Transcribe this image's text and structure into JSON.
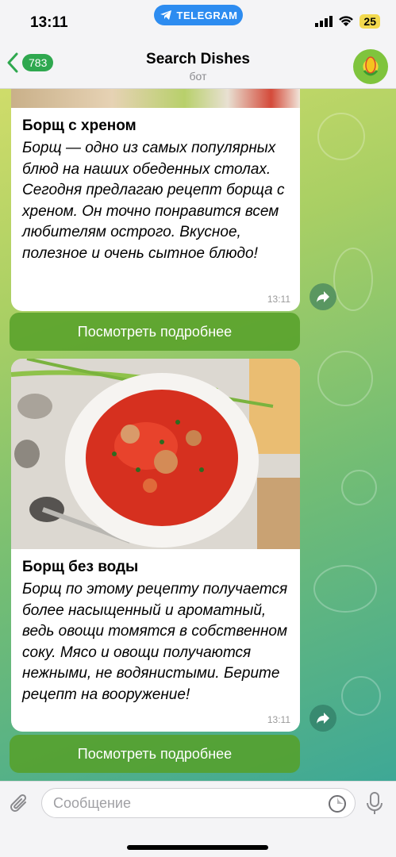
{
  "status_bar": {
    "time": "13:11",
    "app_pill": "TELEGRAM",
    "battery": "25"
  },
  "header": {
    "back_count": "783",
    "title": "Search Dishes",
    "subtitle": "бот"
  },
  "messages": [
    {
      "title": "Борщ с хреном",
      "body": "Борщ — одно из самых популярных блюд на наших обеденных столах. Сегодня предлагаю рецепт борща с хреном. Он точно понравится всем любителям острого. Вкусное, полезное и очень сытное блюдо!",
      "time": "13:11",
      "button": "Посмотреть подробнее"
    },
    {
      "title": "Борщ без воды",
      "body": "Борщ по этому рецепту получается более насыщенный и ароматный, ведь овощи томятся в собственном соку. Мясо и овощи получаются нежными, не водянистыми. Берите рецепт на вооружение!",
      "time": "13:11",
      "button": "Посмотреть подробнее"
    }
  ],
  "input": {
    "placeholder": "Сообщение"
  },
  "colors": {
    "accent": "#2fa84f",
    "button_bg": "#56a028",
    "telegram_blue": "#2d8cf0"
  },
  "icons": {
    "back": "chevron-left-icon",
    "telegram": "telegram-plane-icon",
    "share": "share-arrow-icon",
    "attach": "paperclip-icon",
    "sticker": "sticker-icon",
    "mic": "microphone-icon"
  }
}
